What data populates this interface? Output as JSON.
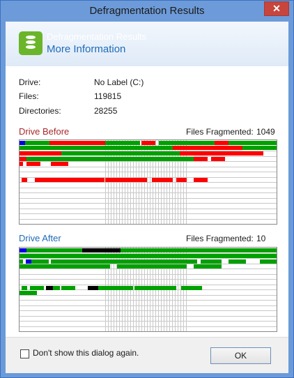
{
  "window": {
    "title": "Defragmentation Results",
    "close_glyph": "✕"
  },
  "header": {
    "subtitle": "Defragmentation Results",
    "title": "More Information",
    "icon": "database-disk-icon"
  },
  "info": [
    {
      "label": "Drive:",
      "value": "No Label (C:)"
    },
    {
      "label": "Files:",
      "value": "119815"
    },
    {
      "label": "Directories:",
      "value": "28255"
    }
  ],
  "before": {
    "title": "Drive Before",
    "frag_label": "Files Fragmented:",
    "frag_value": "1049",
    "title_color": "#a52a2a"
  },
  "after": {
    "title": "Drive After",
    "frag_label": "Files Fragmented:",
    "frag_value": "10",
    "title_color": "#1e6bb8"
  },
  "legend_colors": {
    "fragmented": "#ff0000",
    "contiguous": "#00a000",
    "system": "#0000e0",
    "unmovable": "#000000",
    "free": "#ffffff"
  },
  "footer": {
    "checkbox_label": "Don't show this dialog again.",
    "checkbox_checked": false,
    "ok_label": "OK"
  }
}
